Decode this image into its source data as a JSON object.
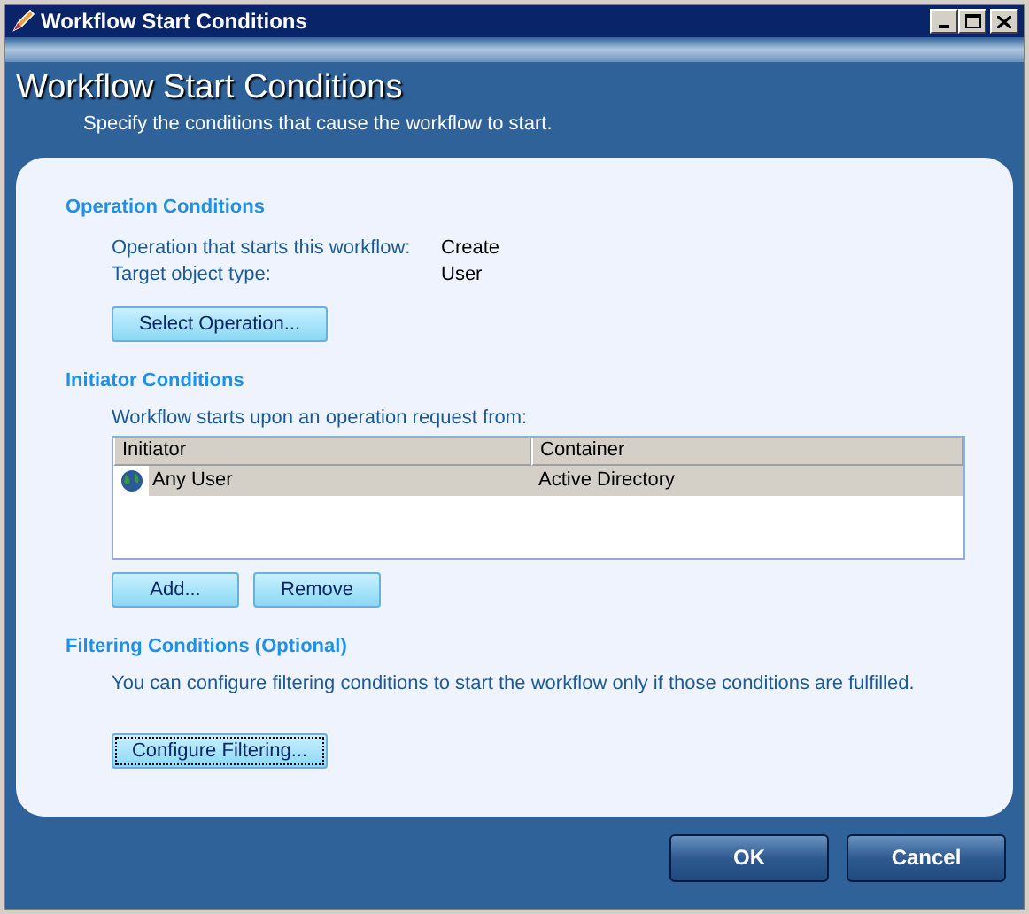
{
  "window": {
    "title": "Workflow Start Conditions"
  },
  "header": {
    "title": "Workflow Start Conditions",
    "subtitle": "Specify the conditions that cause the workflow to start."
  },
  "operation_conditions": {
    "heading": "Operation Conditions",
    "fields": [
      {
        "label": "Operation that starts this workflow:",
        "value": "Create"
      },
      {
        "label": "Target object type:",
        "value": "User"
      }
    ],
    "button": "Select Operation..."
  },
  "initiator_conditions": {
    "heading": "Initiator Conditions",
    "description": "Workflow starts upon an operation request from:",
    "table": {
      "columns": [
        "Initiator",
        "Container"
      ],
      "rows": [
        {
          "initiator": "Any User",
          "container": "Active Directory",
          "selected": true
        }
      ]
    },
    "buttons": [
      "Add...",
      "Remove"
    ]
  },
  "filtering_conditions": {
    "heading": "Filtering Conditions (Optional)",
    "description": "You can configure filtering conditions to start the workflow only if those conditions are fulfilled.",
    "button": "Configure Filtering..."
  },
  "buttons": [
    "OK",
    "Cancel"
  ]
}
